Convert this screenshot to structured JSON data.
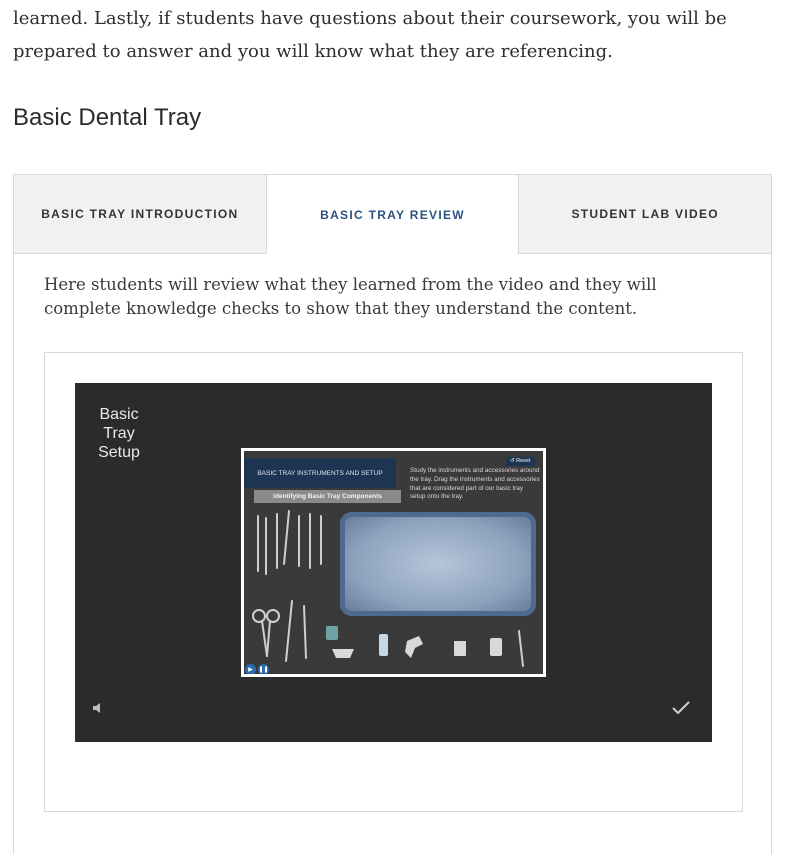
{
  "intro": {
    "text": "learned. Lastly, if students have questions about their coursework, you will be prepared to answer and you will know what they are referencing."
  },
  "section": {
    "title": "Basic Dental Tray"
  },
  "tabs": [
    {
      "label": "BASIC TRAY INTRODUCTION",
      "active": false
    },
    {
      "label": "BASIC TRAY REVIEW",
      "active": true
    },
    {
      "label": "STUDENT LAB VIDEO",
      "active": false
    }
  ],
  "panel": {
    "description": "Here students will review what they learned from the video and they will complete knowledge checks to show that they understand the content."
  },
  "player": {
    "title": "Basic Tray Setup",
    "slide": {
      "header": "BASIC TRAY INSTRUMENTS AND SETUP",
      "subheader": "Identifying Basic Tray Components",
      "instructions": "Study the instruments and accessories around the tray. Drag the instruments and accessories that are considered part of our basic tray setup onto the tray.",
      "reset_label": "Reset"
    },
    "icons": {
      "volume": "volume-icon",
      "check": "check-icon",
      "play": "play-icon",
      "pause": "pause-icon"
    }
  },
  "colors": {
    "active_tab": "#2c5282",
    "player_bg": "#2b2b2b",
    "slide_header": "#1d3552"
  }
}
